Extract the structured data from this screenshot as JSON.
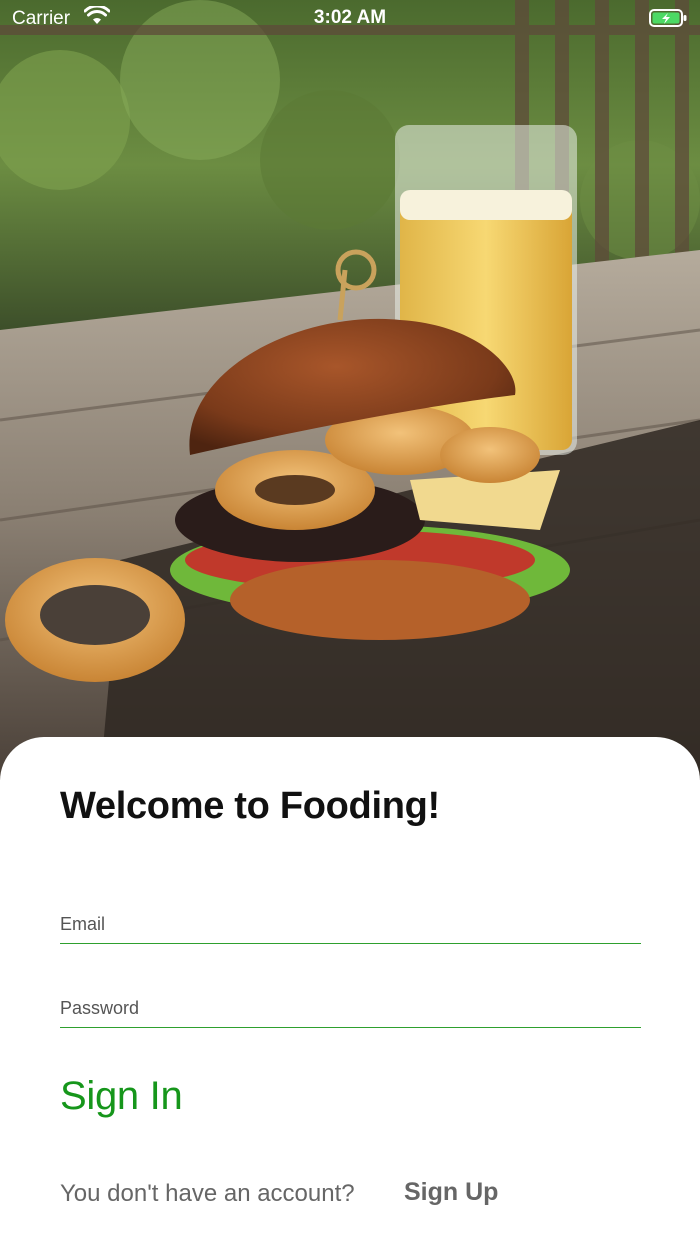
{
  "status_bar": {
    "carrier": "Carrier",
    "time": "3:02 AM",
    "icons": [
      "wifi-icon",
      "battery-charging-icon"
    ]
  },
  "hero": {
    "image_subject": "burger-with-onion-rings-and-beer-photo"
  },
  "login": {
    "title": "Welcome to Fooding!",
    "email_placeholder": "Email",
    "email_value": "",
    "password_placeholder": "Password",
    "password_value": "",
    "sign_in_label": "Sign In",
    "no_account_text": "You don't have an account?",
    "sign_up_label": "Sign Up"
  },
  "colors": {
    "accent": "#16961b",
    "field_underline": "#2ea02e",
    "battery": "#4cd964",
    "title": "#111111",
    "muted_text": "#666666"
  }
}
